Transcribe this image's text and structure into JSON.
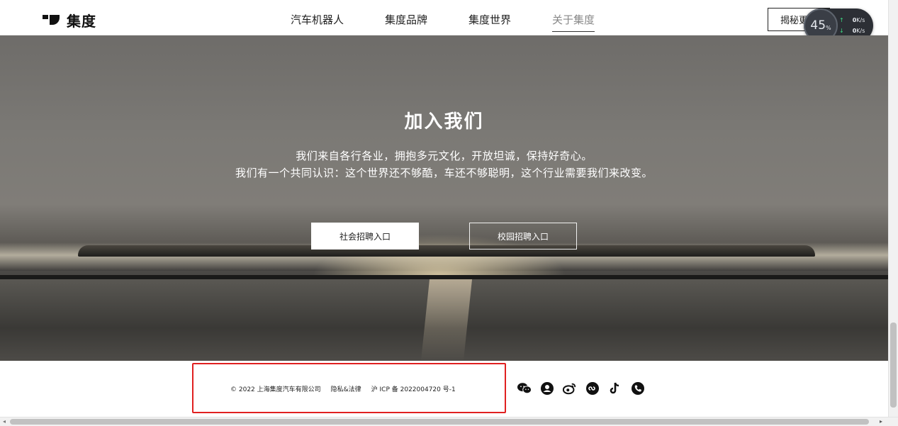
{
  "nav": {
    "logo_text": "集度",
    "items": [
      {
        "label": "汽车机器人",
        "active": false
      },
      {
        "label": "集度品牌",
        "active": false
      },
      {
        "label": "集度世界",
        "active": false
      },
      {
        "label": "关于集度",
        "active": true
      }
    ],
    "reveal_button": "揭秘更多"
  },
  "speed_widget": {
    "percent": "45",
    "percent_unit": "%",
    "up_speed": "0",
    "down_speed": "0",
    "unit": "K/s"
  },
  "hero": {
    "title": "加入我们",
    "line1": "我们来自各行各业，拥抱多元文化，开放坦诚，保持好奇心。",
    "line2": "我们有一个共同认识：这个世界还不够酷，车还不够聪明，这个行业需要我们来改变。",
    "social_button": "社会招聘入口",
    "campus_button": "校园招聘入口"
  },
  "footer": {
    "copyright": "© 2022 上海集度汽车有限公司",
    "privacy": "隐私&法律",
    "icp": "沪 ICP 备 2022004720 号-1",
    "social_icons": [
      "wechat-icon",
      "user-icon",
      "weibo-icon",
      "miniprogram-icon",
      "tiktok-icon",
      "phone-icon"
    ]
  },
  "colors": {
    "highlight_border": "#e02020",
    "nav_active": "#888888"
  }
}
